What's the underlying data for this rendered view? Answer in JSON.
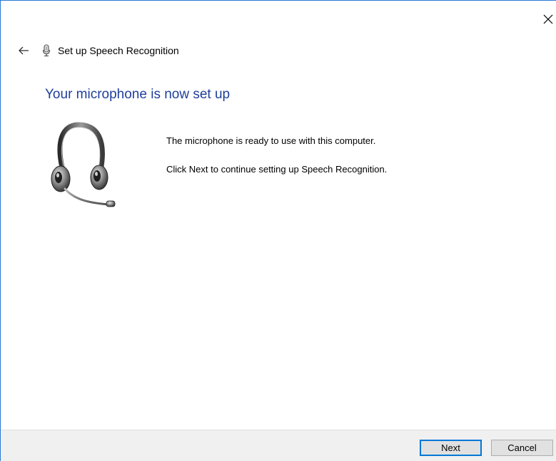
{
  "window": {
    "title": "Set up Speech Recognition"
  },
  "page": {
    "heading": "Your microphone is now set up",
    "line1": "The microphone is ready to use with this computer.",
    "line2": "Click Next to continue setting up Speech Recognition."
  },
  "footer": {
    "next_label": "Next",
    "cancel_label": "Cancel"
  },
  "icons": {
    "close": "close-icon",
    "back": "back-arrow-icon",
    "title": "microphone-icon",
    "illustration": "headset-icon"
  },
  "colors": {
    "heading": "#1e3e9c",
    "footer_bg": "#f0f0f0",
    "accent_border": "#0078d7",
    "window_border": "#2b79d6"
  }
}
